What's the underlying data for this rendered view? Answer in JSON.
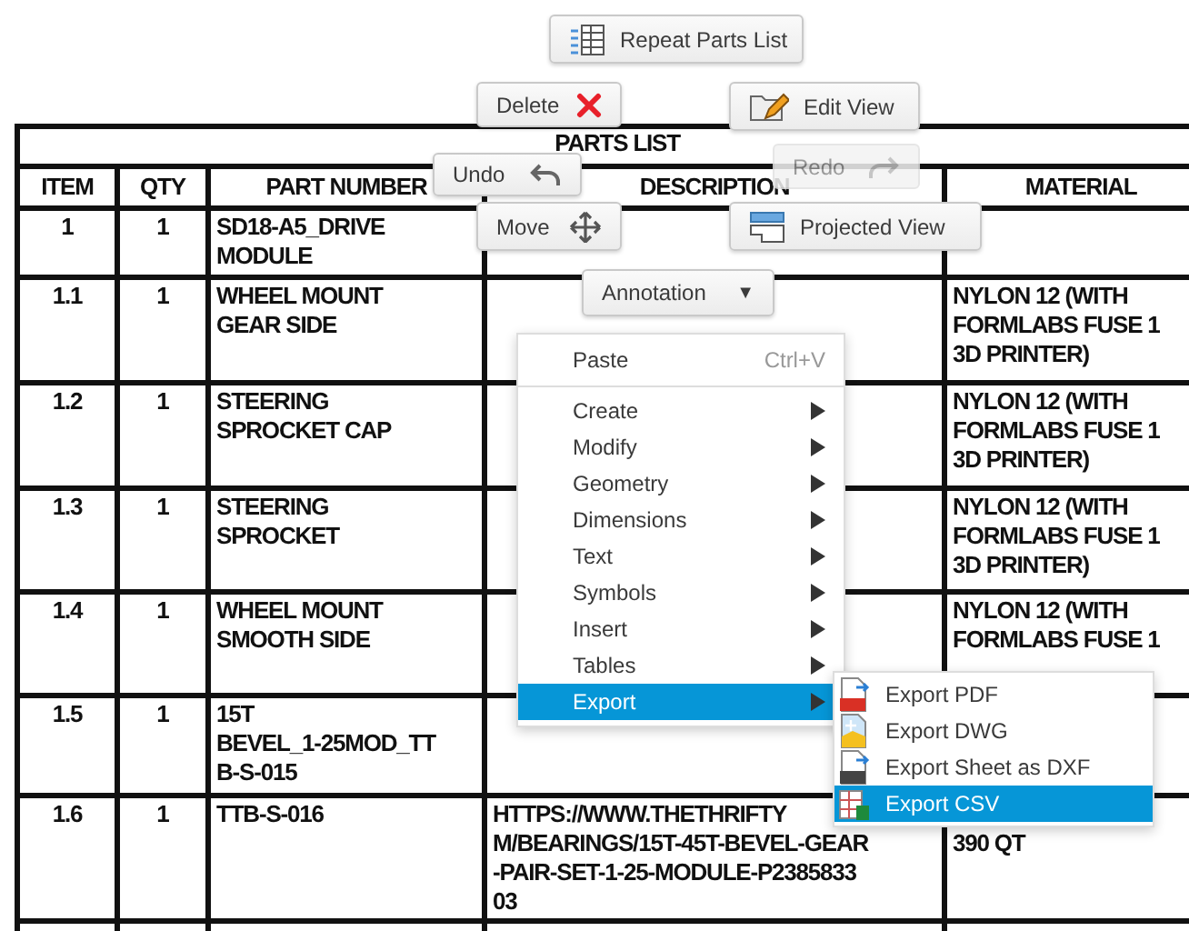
{
  "parts_list": {
    "title": "PARTS LIST",
    "columns": [
      "ITEM",
      "QTY",
      "PART NUMBER",
      "DESCRIPTION",
      "MATERIAL"
    ],
    "rows": [
      {
        "item": "1",
        "qty": "1",
        "part_number": [
          "SD18-A5_DRIVE",
          "MODULE"
        ]
      },
      {
        "item": "1.1",
        "qty": "1",
        "part_number": [
          "WHEEL MOUNT",
          "GEAR SIDE"
        ],
        "material": [
          "NYLON 12 (WITH",
          "FORMLABS FUSE 1",
          "3D PRINTER)"
        ]
      },
      {
        "item": "1.2",
        "qty": "1",
        "part_number": [
          "STEERING",
          "SPROCKET CAP"
        ],
        "material": [
          "NYLON 12 (WITH",
          "FORMLABS FUSE 1",
          "3D PRINTER)"
        ]
      },
      {
        "item": "1.3",
        "qty": "1",
        "part_number": [
          "STEERING",
          "SPROCKET"
        ],
        "material": [
          "NYLON 12 (WITH",
          "FORMLABS FUSE 1",
          "3D PRINTER)"
        ]
      },
      {
        "item": "1.4",
        "qty": "1",
        "part_number": [
          "WHEEL MOUNT",
          "SMOOTH SIDE"
        ],
        "material": [
          "NYLON 12 (WITH",
          "FORMLABS FUSE 1"
        ]
      },
      {
        "item": "1.5",
        "qty": "1",
        "part_number": [
          "15T",
          "BEVEL_1-25MOD_TT",
          "B-S-015"
        ]
      },
      {
        "item": "1.6",
        "qty": "1",
        "part_number": [
          "TTB-S-016"
        ],
        "description": [
          "HTTPS://WWW.THETHRIFTY",
          "M/BEARINGS/15T-45T-BEVEL-GEAR",
          "-PAIR-SET-1-25-MODULE-P2385833",
          "03"
        ],
        "material": [
          "390 QT"
        ]
      }
    ]
  },
  "toolbar": [
    {
      "label": "Repeat Parts List",
      "kind": "table",
      "disabled": false
    },
    {
      "label": "Delete",
      "kind": "delete",
      "disabled": false
    },
    {
      "label": "Edit View",
      "kind": "edit",
      "disabled": false
    },
    {
      "label": "Undo",
      "kind": "undo",
      "disabled": false
    },
    {
      "label": "Redo",
      "kind": "redo",
      "disabled": true
    },
    {
      "label": "Move",
      "kind": "move",
      "disabled": false
    },
    {
      "label": "Projected View",
      "kind": "projected",
      "disabled": false
    }
  ],
  "annotation_dropdown": {
    "label": "Annotation",
    "caret": "▼"
  },
  "context_menu": {
    "items": [
      {
        "label": "Paste",
        "shortcut": "Ctrl+V",
        "has_submenu": false,
        "separator_after": true,
        "selected": false
      },
      {
        "label": "Create",
        "has_submenu": true,
        "separator_after": false,
        "selected": false
      },
      {
        "label": "Modify",
        "has_submenu": true,
        "separator_after": false,
        "selected": false
      },
      {
        "label": "Geometry",
        "has_submenu": true,
        "separator_after": false,
        "selected": false
      },
      {
        "label": "Dimensions",
        "has_submenu": true,
        "separator_after": false,
        "selected": false
      },
      {
        "label": "Text",
        "has_submenu": true,
        "separator_after": false,
        "selected": false
      },
      {
        "label": "Symbols",
        "has_submenu": true,
        "separator_after": false,
        "selected": false
      },
      {
        "label": "Insert",
        "has_submenu": true,
        "separator_after": false,
        "selected": false
      },
      {
        "label": "Tables",
        "has_submenu": true,
        "separator_after": false,
        "selected": false
      },
      {
        "label": "Export",
        "has_submenu": true,
        "separator_after": false,
        "selected": true
      }
    ]
  },
  "export_submenu": {
    "items": [
      {
        "label": "Export PDF",
        "kind": "pdf",
        "selected": false
      },
      {
        "label": "Export DWG",
        "kind": "dwg",
        "selected": false
      },
      {
        "label": "Export Sheet as DXF",
        "kind": "dxf",
        "selected": false
      },
      {
        "label": "Export CSV",
        "kind": "csv",
        "selected": true
      }
    ]
  }
}
